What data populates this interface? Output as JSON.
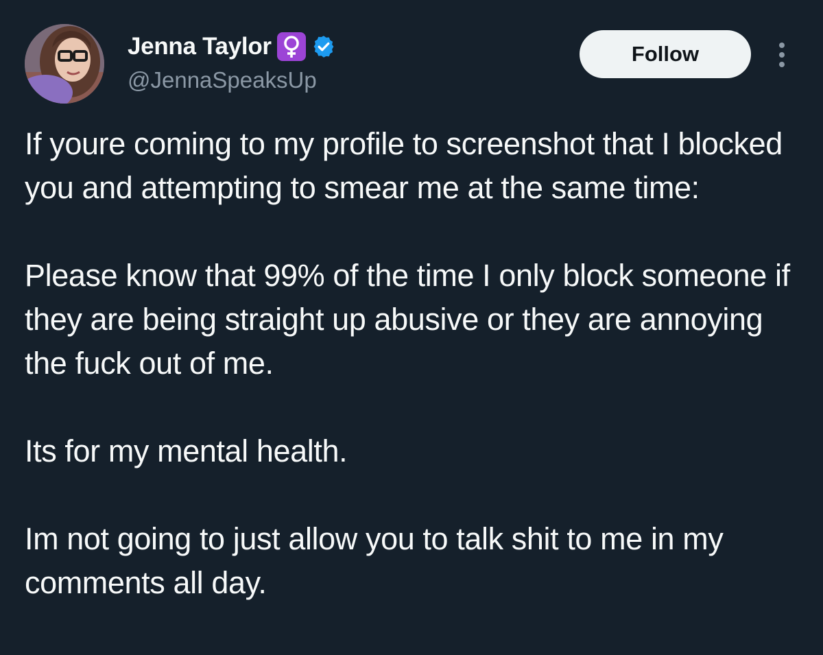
{
  "author": {
    "display_name": "Jenna Taylor",
    "handle": "@JennaSpeaksUp",
    "emoji_badge": "female-sign-emoji",
    "verified": true,
    "verified_color": "#1d9bf0"
  },
  "actions": {
    "follow_label": "Follow",
    "more_icon": "more-vertical-icon"
  },
  "tweet": {
    "paragraphs": [
      "If youre coming to my profile to screenshot that I blocked you and attempting to smear me at the same time:",
      "Please know that 99% of the time I only block someone if they are being straight up abusive or they are annoying the fuck out of me.",
      "Its for my mental health.",
      "Im not going to just allow you to talk shit to me in my comments all day."
    ]
  },
  "theme": {
    "background": "#15202b",
    "text": "#f7f9f9",
    "secondary_text": "#8b98a5",
    "button_bg": "#eff3f4",
    "badge_purple": "#9c44d6"
  }
}
